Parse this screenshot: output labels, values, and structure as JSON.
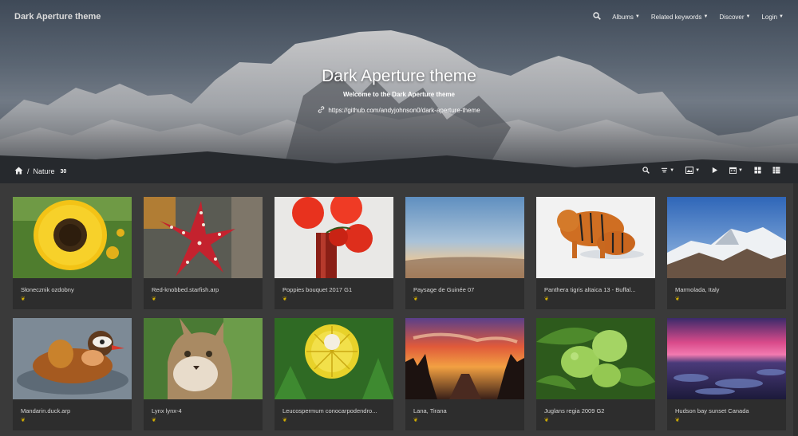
{
  "header": {
    "brand": "Dark Aperture theme",
    "nav": [
      {
        "label": "Albums"
      },
      {
        "label": "Related keywords"
      },
      {
        "label": "Discover"
      },
      {
        "label": "Login"
      }
    ],
    "search_icon": "search-icon"
  },
  "hero": {
    "title": "Dark Aperture theme",
    "subtitle": "Welcome to the Dark Aperture theme",
    "link": "https://github.com/andyjohnson0/dark-aperture-theme"
  },
  "breadcrumb": {
    "separator": "/",
    "album": "Nature",
    "count": "30"
  },
  "gallery": [
    {
      "caption": "Słonecznik ozdobny",
      "icon": "sunflower"
    },
    {
      "caption": "Red-knobbed.starfish.arp",
      "icon": "starfish"
    },
    {
      "caption": "Poppies bouquet 2017 G1",
      "icon": "poppies"
    },
    {
      "caption": "Paysage de Guinée 07",
      "icon": "sunset-sky"
    },
    {
      "caption": "Panthera tigris altaica 13 - Buffal...",
      "icon": "tiger"
    },
    {
      "caption": "Marmolada, Italy",
      "icon": "mountain"
    },
    {
      "caption": "Mandarin.duck.arp",
      "icon": "duck"
    },
    {
      "caption": "Lynx lynx-4",
      "icon": "lynx"
    },
    {
      "caption": "Leucospermum conocarpodendro...",
      "icon": "flower"
    },
    {
      "caption": "Lana, Tirana",
      "icon": "city-sunset"
    },
    {
      "caption": "Juglans regia 2009 G2",
      "icon": "walnuts"
    },
    {
      "caption": "Hudson bay sunset Canada",
      "icon": "bay-sunset"
    }
  ],
  "colors": {
    "accent": "#d8b200",
    "card": "#2d2d2d",
    "background": "#3a3a3a"
  }
}
